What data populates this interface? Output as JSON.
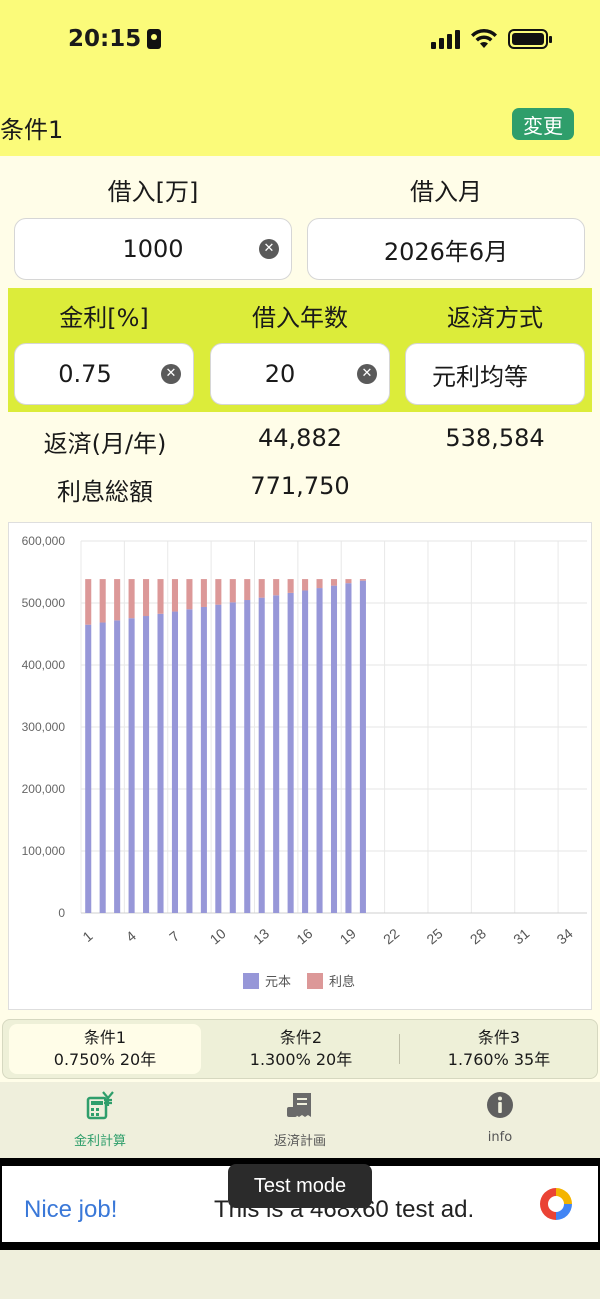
{
  "status": {
    "time": "20:15"
  },
  "header": {
    "title": "条件1",
    "change_label": "変更"
  },
  "form": {
    "loan_label": "借入[万]",
    "loan_value": "1000",
    "month_label": "借入月",
    "month_value": "2026年6月",
    "rate_label": "金利[%]",
    "rate_value": "0.75",
    "years_label": "借入年数",
    "years_value": "20",
    "method_label": "返済方式",
    "method_value": "元利均等",
    "clear_glyph": "✕"
  },
  "results": {
    "repay_label": "返済(月/年)",
    "monthly": "44,882",
    "yearly": "538,584",
    "interest_label": "利息総額",
    "interest_total": "771,750"
  },
  "chart_data": {
    "type": "bar",
    "stacked": true,
    "categories": [
      1,
      2,
      3,
      4,
      5,
      6,
      7,
      8,
      9,
      10,
      11,
      12,
      13,
      14,
      15,
      16,
      17,
      18,
      19,
      20,
      21,
      22,
      23,
      24,
      25,
      26,
      27,
      28,
      29,
      30,
      31,
      32,
      33,
      34,
      35
    ],
    "tick_labels": [
      "1",
      "4",
      "7",
      "10",
      "13",
      "16",
      "19",
      "22",
      "25",
      "28",
      "31",
      "34"
    ],
    "y_tick_labels": [
      "0",
      "100,000",
      "200,000",
      "300,000",
      "400,000",
      "500,000",
      "600,000"
    ],
    "ylim": [
      0,
      600000
    ],
    "series": [
      {
        "name": "元本",
        "color": "#9797d8",
        "values": [
          465000,
          468500,
          472000,
          475500,
          479000,
          482600,
          486200,
          489900,
          493600,
          497300,
          501000,
          504800,
          508600,
          512400,
          516300,
          520200,
          524100,
          528000,
          532000,
          536000
        ]
      },
      {
        "name": "利息",
        "color": "#dc9898",
        "values": [
          73584,
          70084,
          66584,
          63084,
          59584,
          55984,
          52384,
          48684,
          44984,
          41284,
          37584,
          33784,
          29984,
          26184,
          22284,
          18384,
          14484,
          10584,
          6584,
          2584
        ]
      }
    ],
    "grid": true,
    "legend": "bottom"
  },
  "conditions": [
    {
      "name": "条件1",
      "detail": "0.750% 20年"
    },
    {
      "name": "条件2",
      "detail": "1.300% 20年"
    },
    {
      "name": "条件3",
      "detail": "1.760% 35年"
    }
  ],
  "nav": {
    "calc": "金利計算",
    "plan": "返済計画",
    "info": "info"
  },
  "ad": {
    "nice": "Nice job!",
    "text": "This is a 468x60 test ad.",
    "toast": "Test mode"
  },
  "colors": {
    "header": "#fbfb7a",
    "band": "#dcec3a",
    "accent": "#2f9e6b"
  }
}
